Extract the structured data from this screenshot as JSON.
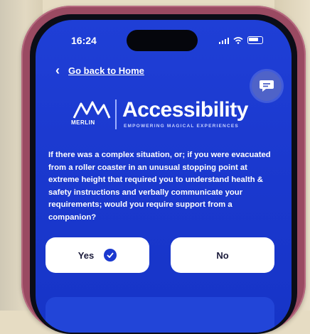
{
  "status_bar": {
    "time": "16:24"
  },
  "nav": {
    "back_label": "Go back to Home"
  },
  "logo": {
    "brand": "MERLIN",
    "title": "Accessibility",
    "tagline": "EMPOWERING MAGICAL EXPERIENCES"
  },
  "question": {
    "text": "If there was a complex situation, or; if you were evacuated from a roller coaster in an unusual stopping point at extreme height that required you to understand health & safety instructions and verbally communicate your requirements; would you require support from a companion?"
  },
  "answers": {
    "yes_label": "Yes",
    "no_label": "No"
  },
  "icons": {
    "back": "chevron-left-icon",
    "chat": "chat-bubble-icon",
    "selected": "check-circle-icon"
  },
  "colors": {
    "screen_bg": "#1f3fd6",
    "button_bg": "#ffffff",
    "case": "#9a4a62"
  }
}
